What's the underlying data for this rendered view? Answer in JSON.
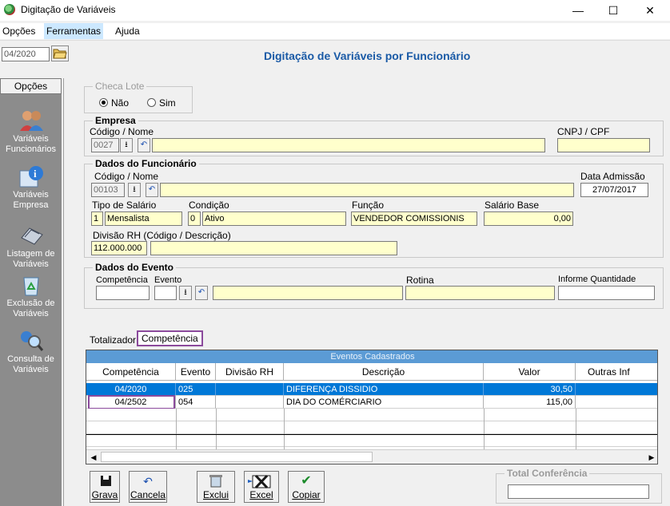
{
  "window": {
    "title": "Digitação de Variáveis",
    "controls": {
      "minimize": "—",
      "maximize": "☐",
      "close": "✕"
    }
  },
  "menu": {
    "items": [
      "Opções",
      "Ferramentas",
      "Ajuda"
    ]
  },
  "topbar": {
    "period": "04/2020",
    "title": "Digitação de Variáveis por Funcionário"
  },
  "sidebar": {
    "header": "Opções",
    "items": [
      {
        "label": "Variáveis Funcionários",
        "icon": "users-icon"
      },
      {
        "label": "Variáveis Empresa",
        "icon": "info-icon"
      },
      {
        "label": "Listagem de Variáveis",
        "icon": "printer-icon"
      },
      {
        "label": "Exclusão de Variáveis",
        "icon": "recycle-bin-icon"
      },
      {
        "label": "Consulta de Variáveis",
        "icon": "magnifier-icon"
      }
    ]
  },
  "checa_lote": {
    "legend": "Checa Lote",
    "nao": "Não",
    "sim": "Sim",
    "selected": "Não"
  },
  "empresa": {
    "legend": "Empresa",
    "codigo_label": "Código / Nome",
    "codigo": "0027",
    "nome": "",
    "cnpj_label": "CNPJ / CPF",
    "cnpj": ""
  },
  "funcionario": {
    "legend": "Dados do Funcionário",
    "codigo_label": "Código / Nome",
    "codigo": "00103",
    "nome": "",
    "admissao_label": "Data Admissão",
    "admissao": "27/07/2017",
    "tipo_salario_label": "Tipo de Salário",
    "tipo_salario_code": "1",
    "tipo_salario": "Mensalista",
    "condicao_label": "Condição",
    "condicao_code": "0",
    "condicao": "Ativo",
    "funcao_label": "Função",
    "funcao": "VENDEDOR COMISSIONIS",
    "salario_label": "Salário Base",
    "salario": "0,00",
    "divisao_label": "Divisão RH (Código / Descrição)",
    "divisao_code": "112.000.000",
    "divisao_desc": ""
  },
  "evento": {
    "legend": "Dados do Evento",
    "competencia_label": "Competência",
    "evento_label": "Evento",
    "rotina_label": "Rotina",
    "quantidade_label": "Informe Quantidade"
  },
  "tabs": [
    "Totalizador",
    "Competência"
  ],
  "grid": {
    "caption": "Eventos Cadastrados",
    "columns": [
      "Competência",
      "Evento",
      "Divisão RH",
      "Descrição",
      "Valor",
      "Outras Inf"
    ],
    "rows": [
      {
        "competencia": "04/2020",
        "evento": "025",
        "divisao": "",
        "descricao": "DIFERENÇA DISSIDIO",
        "valor": "30,50",
        "outras": ""
      },
      {
        "competencia": "04/2502",
        "evento": "054",
        "divisao": "",
        "descricao": "DIA DO COMÉRCIARIO",
        "valor": "115,00",
        "outras": ""
      }
    ]
  },
  "buttons": {
    "grava": "Grava",
    "cancela": "Cancela",
    "exclui": "Exclui",
    "excel": "Excel",
    "copiar": "Copiar"
  },
  "total_conferencia": {
    "legend": "Total Conferência",
    "value": ""
  },
  "colors": {
    "accent": "#0078d7",
    "title_blue": "#1a5aa6",
    "input_bg": "#ffffcc",
    "highlight": "#8b4a9c"
  }
}
